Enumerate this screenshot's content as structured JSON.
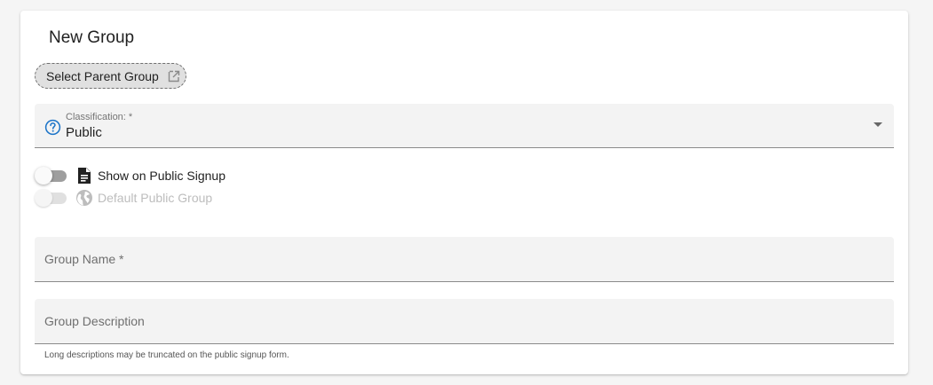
{
  "form": {
    "title": "New Group",
    "select_parent_label": "Select Parent Group",
    "classification": {
      "label": "Classification: *",
      "value": "Public"
    },
    "toggles": [
      {
        "label": "Show on Public Signup",
        "icon": "document-icon",
        "on": false,
        "disabled": false
      },
      {
        "label": "Default Public Group",
        "icon": "globe-icon",
        "on": false,
        "disabled": true
      }
    ],
    "group_name_placeholder": "Group Name *",
    "group_description_placeholder": "Group Description",
    "description_hint": "Long descriptions may be truncated on the public signup form."
  },
  "colors": {
    "accent_blue": "#1a73c8",
    "chip_background": "#e0e0e0",
    "field_background": "#f3f3f3"
  }
}
